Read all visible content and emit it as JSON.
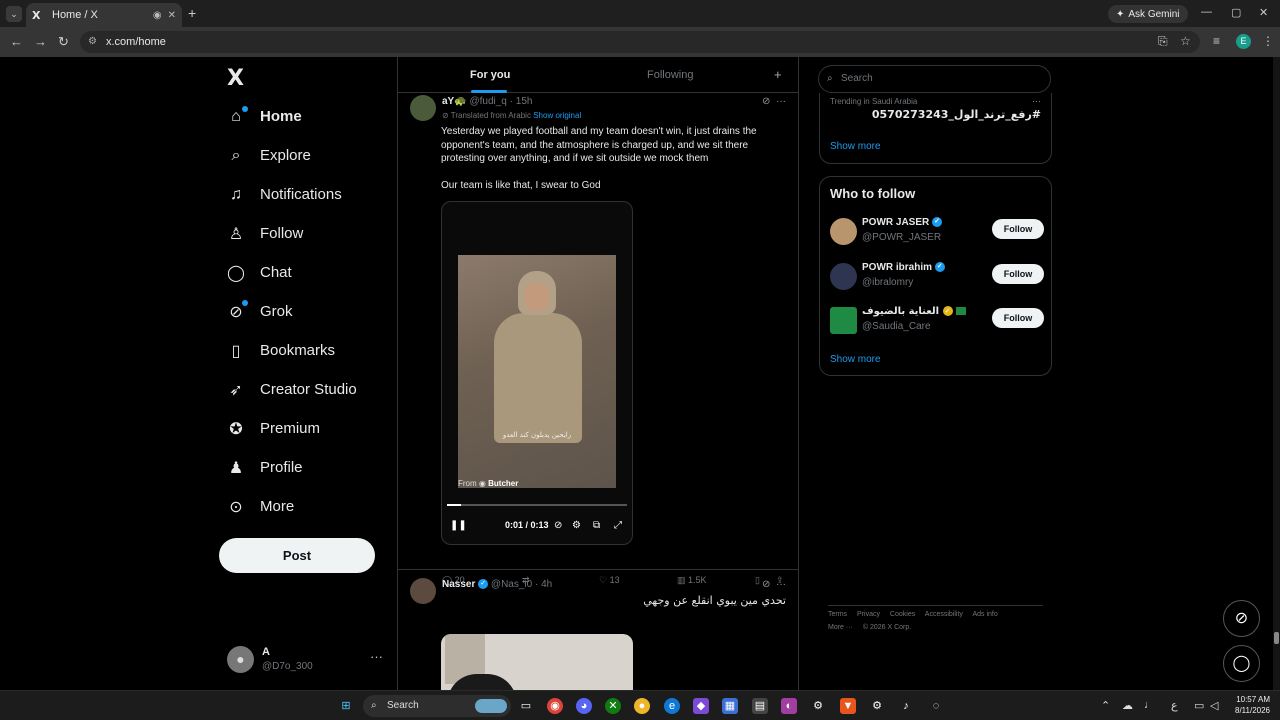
{
  "browser": {
    "tab_title": "Home / X",
    "tab_favicon": "X",
    "url": "x.com/home",
    "gemini_label": "Ask Gemini",
    "profile_initial": "E"
  },
  "nav": {
    "logo": "X",
    "items": [
      {
        "label": "Home",
        "icon": "home-icon"
      },
      {
        "label": "Explore",
        "icon": "search-icon"
      },
      {
        "label": "Notifications",
        "icon": "bell-icon"
      },
      {
        "label": "Follow",
        "icon": "person-add-icon"
      },
      {
        "label": "Chat",
        "icon": "chat-icon"
      },
      {
        "label": "Grok",
        "icon": "grok-icon"
      },
      {
        "label": "Bookmarks",
        "icon": "bookmark-icon"
      },
      {
        "label": "Creator Studio",
        "icon": "rocket-icon"
      },
      {
        "label": "Premium",
        "icon": "verified-icon"
      },
      {
        "label": "Profile",
        "icon": "profile-icon"
      },
      {
        "label": "More",
        "icon": "more-circle-icon"
      }
    ],
    "post_label": "Post",
    "account": {
      "name": "A",
      "handle": "@D7o_300"
    }
  },
  "feed": {
    "tabs": [
      "For you",
      "Following"
    ],
    "tweet1": {
      "name": "aY🐢",
      "handle": "@fudi_q",
      "time": "15h",
      "translated": "Translated from Arabic",
      "show_original": "Show original",
      "text1": "Yesterday we played football and my team doesn't win, it just drains the opponent's team, and the atmosphere is charged up, and we sit there protesting over anything, and if we sit outside we mock them",
      "text2": "Our team is like that, I swear to God",
      "video_caption": "رايحين يدبلون كند العدو",
      "from_prefix": "From",
      "from_name": "Butcher",
      "video_time": "0:01 / 0:13",
      "video_progress": 0.08,
      "replies": "20",
      "likes": "13",
      "views": "1.5K"
    },
    "tweet2": {
      "name": "Nasser",
      "handle": "@Nas_i0",
      "time": "4h",
      "text": "تحدي مين يبوي انقلع عن وجهي"
    }
  },
  "sidebar": {
    "search_placeholder": "Search",
    "trend_context": "Trending in Saudi Arabia",
    "trend_name": "#رفع_ترند_الول_0570273243",
    "show_more": "Show more",
    "who_to_follow_title": "Who to follow",
    "people": [
      {
        "name": "POWR JASER",
        "handle": "@POWR_JASER",
        "badge": "blue",
        "avatar_color": "#b9956e"
      },
      {
        "name": "POWR ibrahim",
        "handle": "@ibralomry",
        "badge": "blue",
        "avatar_color": "#2e3550"
      },
      {
        "name": "العناية بالضيوف",
        "handle": "@Saudia_Care",
        "badge": "gold",
        "avatar_color": "#1f8a44"
      }
    ],
    "follow_label": "Follow",
    "footer_links": [
      "Terms",
      "Privacy",
      "Cookies",
      "Accessibility",
      "Ads info",
      "More ···",
      "© 2026 X Corp."
    ]
  },
  "taskbar": {
    "search_label": "Search",
    "time": "10:57 AM",
    "date": "8/11/2026",
    "lang": "ع"
  }
}
